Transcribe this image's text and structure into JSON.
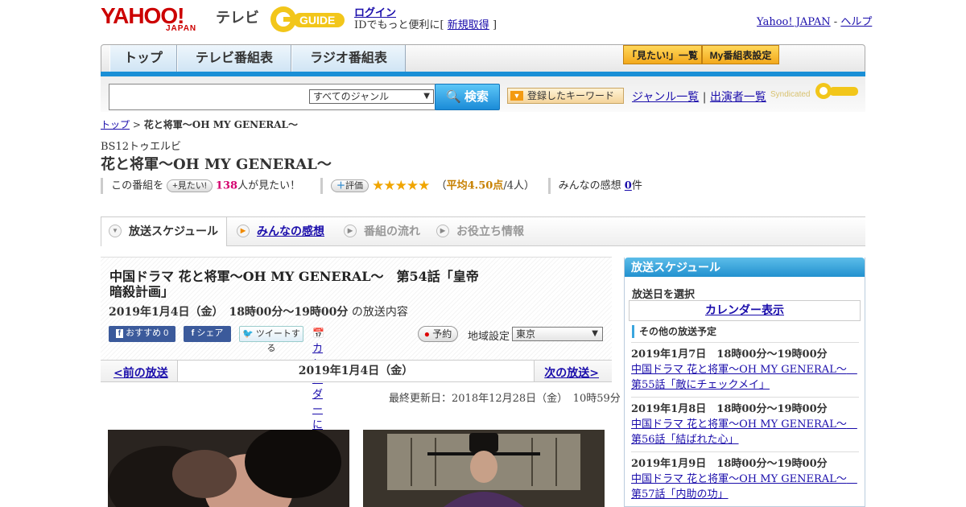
{
  "header": {
    "logo_yahoo": "YAHOO!",
    "logo_japan": "JAPAN",
    "logo_tv": "テレビ",
    "logo_gguide": "G GUIDE",
    "login": "ログイン",
    "login_desc_prefix": "IDでもっと便利に[",
    "signup": "新規取得",
    "login_desc_suffix": "]",
    "yahoo_japan_link": "Yahoo! JAPAN",
    "dash": "-",
    "help_link": "ヘルプ"
  },
  "nav": {
    "tabs": [
      "トップ",
      "テレビ番組表",
      "ラジオ番組表"
    ],
    "want_list": "「見たい!」一覧",
    "my_settings": "My番組表設定"
  },
  "search": {
    "genre_selected": "すべてのジャンル",
    "button": "検索",
    "keyword_button": "登録したキーワード",
    "genre_list": "ジャンル一覧",
    "sep": "|",
    "cast_list": "出演者一覧",
    "syndicated": "Syndicated"
  },
  "breadcrumb": {
    "top": "トップ",
    "sep": ">",
    "current": "花と将軍～OH MY GENERAL～"
  },
  "program": {
    "channel": "BS12トゥエルビ",
    "title": "花と将軍～OH MY GENERAL～"
  },
  "stats": {
    "this_program": "この番組を",
    "want_btn": "+見たい!",
    "want_count": "138",
    "want_suffix": "人が見たい！",
    "rating_btn": "評価",
    "stars": "★★★★★",
    "rating_value": 4.5,
    "avg_prefix": "（",
    "avg_text": "平均4.50点",
    "avg_suffix": "/4人）",
    "reviews_label": "みんなの感想",
    "reviews_count": "0",
    "reviews_unit": "件"
  },
  "subtabs": [
    "放送スケジュール",
    "みんなの感想",
    "番組の流れ",
    "お役立ち情報"
  ],
  "episode": {
    "title": "中国ドラマ 花と将軍～OH MY GENERAL～　第54話「皇帝暗殺計画」",
    "date": "2019年1月4日（金）　18時00分～19時00分",
    "date_suffix": "の放送内容",
    "share": {
      "recommend": "おすすめ 0",
      "facebook_share": "シェア",
      "tweet": "ツイートする",
      "calendar": "カレンダーに登録",
      "reserve": "予約",
      "region_label": "地域設定",
      "region": "東京"
    }
  },
  "pager": {
    "prev": "<前の放送",
    "date": "2019年1月4日（金）",
    "next": "次の放送>"
  },
  "last_updated": "最終更新日：2018年12月28日（金）　10時59分",
  "sidebar": {
    "title": "放送スケジュール",
    "select_date": "放送日を選択",
    "calendar": "カレンダー表示",
    "other_schedules": "その他の放送予定",
    "items": [
      {
        "date": "2019年1月7日　18時00分～19時00分",
        "title": "中国ドラマ 花と将軍～OH MY GENERAL～　第55話「敵にチェックメイ」"
      },
      {
        "date": "2019年1月8日　18時00分～19時00分",
        "title": "中国ドラマ 花と将軍～OH MY GENERAL～　第56話「結ばれた心」"
      },
      {
        "date": "2019年1月9日　18時00分～19時00分",
        "title": "中国ドラマ 花と将軍～OH MY GENERAL～　第57話「内助の功」"
      }
    ]
  },
  "colors": {
    "accent_blue": "#1a8fd6",
    "yahoo_red": "#cc0000",
    "gold": "#f3a91c",
    "pink": "#d4006e"
  }
}
